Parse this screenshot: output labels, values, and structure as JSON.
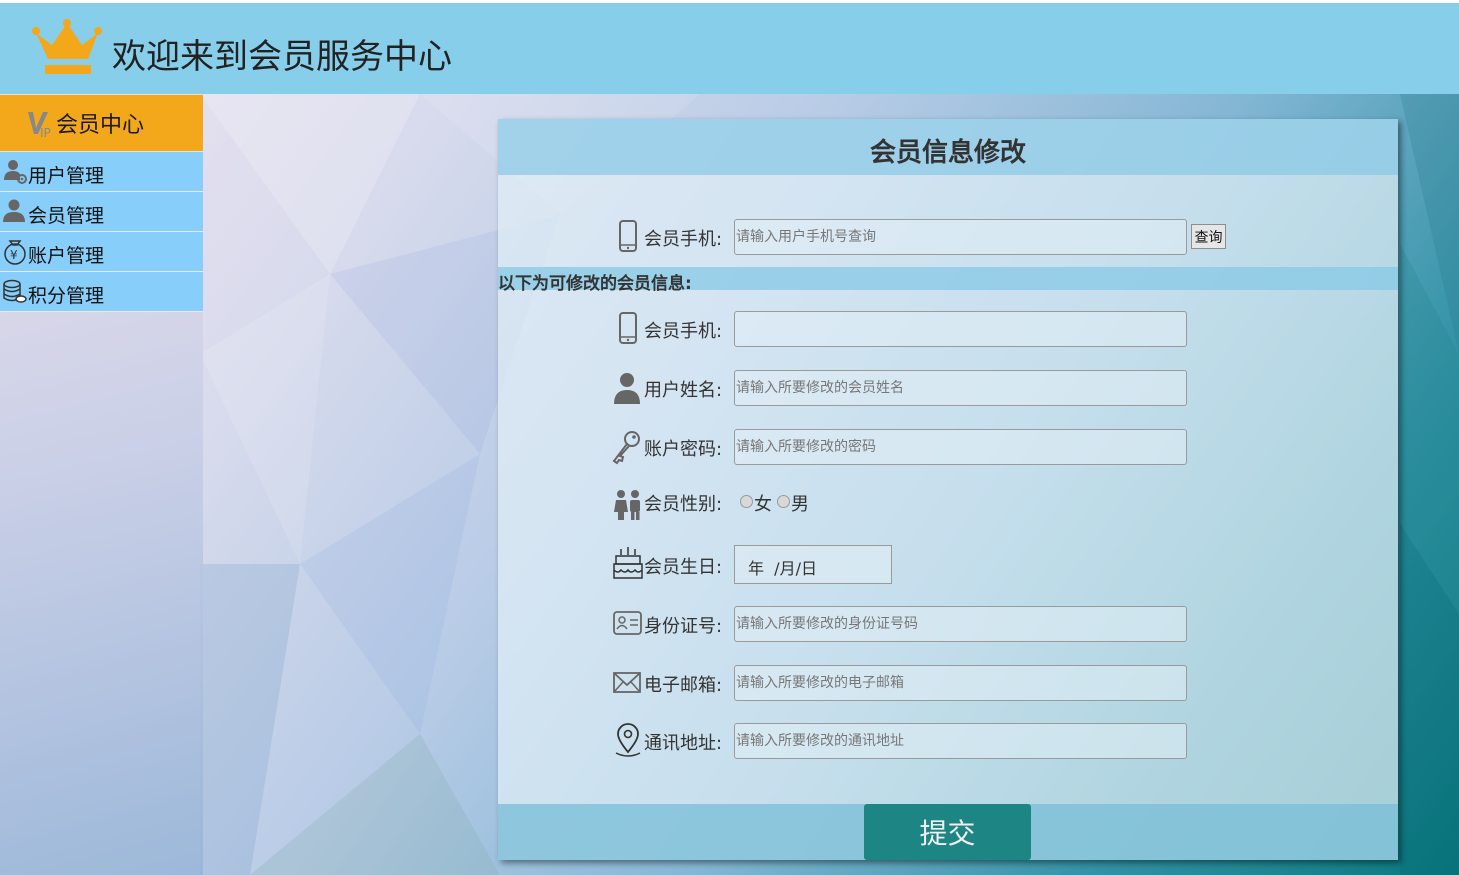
{
  "header": {
    "title": "欢迎来到会员服务中心",
    "logo_icon": "crown-icon",
    "logo_color": "#f3a81b"
  },
  "sidebar": {
    "title": "会员中心",
    "title_icon": "vip-icon",
    "items": [
      {
        "label": "用户管理",
        "icon": "user-gear-icon"
      },
      {
        "label": "会员管理",
        "icon": "user-icon"
      },
      {
        "label": "账户管理",
        "icon": "money-bag-icon"
      },
      {
        "label": "积分管理",
        "icon": "coin-stack-icon"
      }
    ]
  },
  "form": {
    "title": "会员信息修改",
    "query": {
      "label": "会员手机:",
      "placeholder": "请输入用户手机号查询",
      "button": "查询"
    },
    "section_label": "以下为可修改的会员信息:",
    "phone": {
      "label": "会员手机:",
      "value": ""
    },
    "name": {
      "label": "用户姓名:",
      "placeholder": "请输入所要修改的会员姓名"
    },
    "password": {
      "label": "账户密码:",
      "placeholder": "请输入所要修改的密码"
    },
    "gender": {
      "label": "会员性别:",
      "options": [
        "女",
        "男"
      ]
    },
    "birthday": {
      "label": "会员生日:",
      "value": "年  /月/日"
    },
    "id_card": {
      "label": "身份证号:",
      "placeholder": "请输入所要修改的身份证号码"
    },
    "email": {
      "label": "电子邮箱:",
      "placeholder": "请输入所要修改的电子邮箱"
    },
    "address": {
      "label": "通讯地址:",
      "placeholder": "请输入所要修改的通讯地址"
    },
    "submit": "提交"
  },
  "colors": {
    "header_bg": "#87ceeb",
    "sidebar_head_bg": "#f3a81b",
    "sidebar_item_bg": "#87cefa",
    "submit_bg": "#1e8585"
  }
}
